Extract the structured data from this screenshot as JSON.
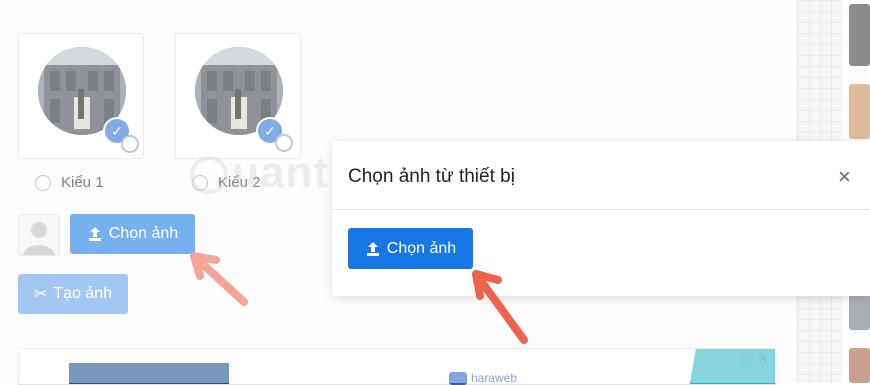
{
  "options": [
    {
      "label": "Kiểu 1"
    },
    {
      "label": "Kiểu 2"
    }
  ],
  "buttons": {
    "choose_photo": "Chọn ảnh",
    "create_photo": "Tạo ảnh"
  },
  "modal": {
    "title": "Chọn ảnh từ thiết bị",
    "close_glyph": "×",
    "upload_button": "Chọn ảnh"
  },
  "watermark": "uantrimang",
  "ad": {
    "brand": "haraweb",
    "info_glyph": "ⓘ",
    "close_glyph": "X"
  },
  "colors": {
    "primary": "#1677e5",
    "primary_disabled": "#5f9fe8",
    "arrow": "#f0614f"
  },
  "icons": {
    "upload": "upload-icon",
    "scissors": "scissors-icon",
    "check": "check-icon",
    "zoom": "zoom-icon",
    "avatar": "user-silhouette-icon"
  }
}
